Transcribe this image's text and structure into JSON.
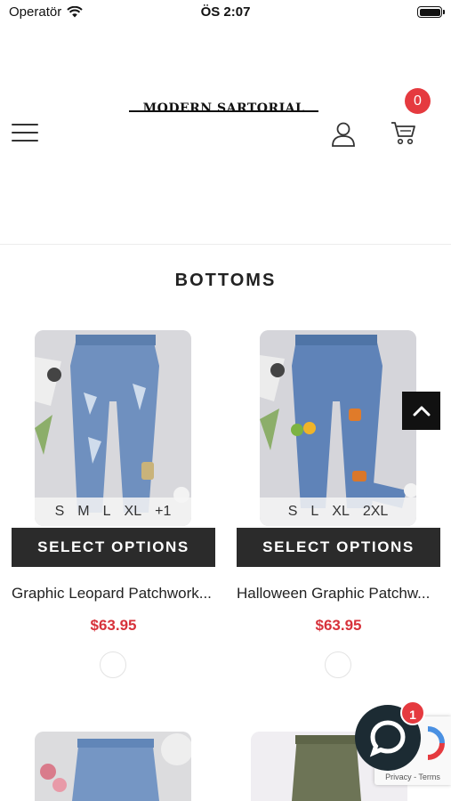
{
  "status_bar": {
    "carrier": "Operatör",
    "time": "ÖS 2:07"
  },
  "header": {
    "logo_text": "MODERN SARTORIAL",
    "cart_count": "0",
    "icons": {
      "menu": "hamburger-menu-icon",
      "account": "user-icon",
      "cart": "cart-icon"
    }
  },
  "section": {
    "title": "BOTTOMS"
  },
  "products": [
    {
      "sizes": [
        "S",
        "M",
        "L",
        "XL",
        "+1"
      ],
      "button_label": "SELECT OPTIONS",
      "name": "Graphic Leopard Patchwork...",
      "price": "$63.95"
    },
    {
      "sizes": [
        "S",
        "L",
        "XL",
        "2XL"
      ],
      "button_label": "SELECT OPTIONS",
      "name": "Halloween Graphic Patchw...",
      "price": "$63.95"
    }
  ],
  "recaptcha": {
    "links": "Privacy - Terms"
  },
  "chat": {
    "badge": "1"
  },
  "colors": {
    "accent_red": "#e53a3f",
    "price_red": "#d7323b",
    "button_dark": "#2b2b2b",
    "denim_blue": "#6f90bf"
  }
}
